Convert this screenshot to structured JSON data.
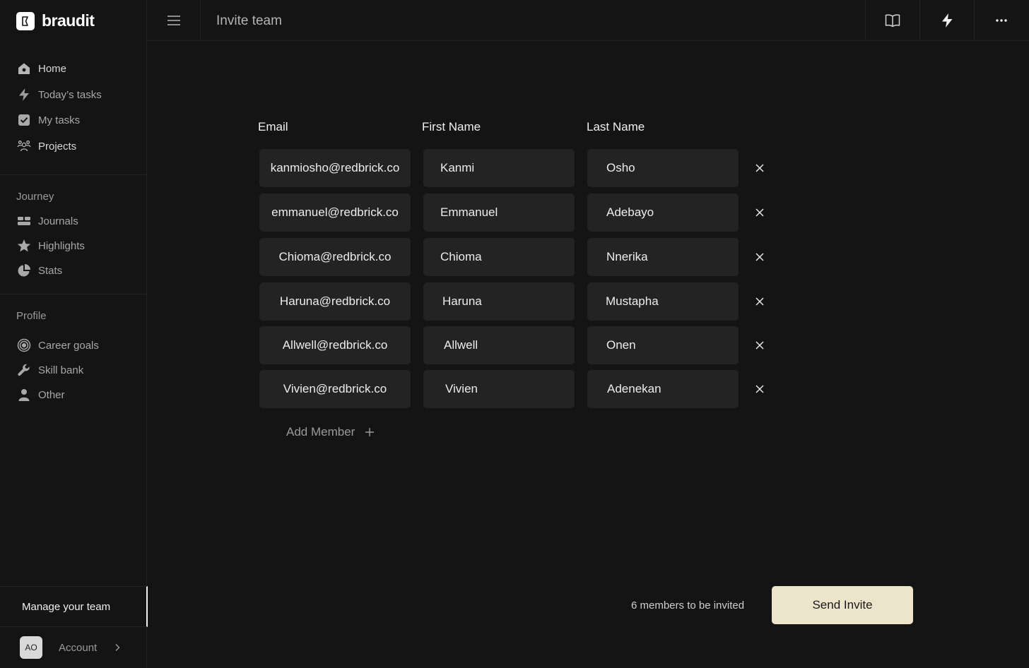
{
  "brand": {
    "name": "braudit"
  },
  "header": {
    "title": "Invite team"
  },
  "nav": {
    "main": [
      {
        "label": "Home",
        "icon": "home-icon"
      },
      {
        "label": "Today’s tasks",
        "icon": "lightning-icon"
      },
      {
        "label": "My tasks",
        "icon": "checkbox-icon"
      },
      {
        "label": "Projects",
        "icon": "people-icon"
      }
    ],
    "journey_label": "Journey",
    "journey": [
      {
        "label": "Journals",
        "icon": "journals-icon"
      },
      {
        "label": "Highlights",
        "icon": "star-icon"
      },
      {
        "label": "Stats",
        "icon": "pie-chart-icon"
      }
    ],
    "profile_label": "Profile",
    "profile": [
      {
        "label": "Career goals",
        "icon": "target-icon"
      },
      {
        "label": "Skill bank",
        "icon": "wrench-icon"
      },
      {
        "label": "Other",
        "icon": "user-icon"
      }
    ]
  },
  "sidebar_footer": {
    "manage_label": "Manage your team",
    "avatar_initials": "AO",
    "account_label": "Account"
  },
  "form": {
    "columns": {
      "email": "Email",
      "first": "First Name",
      "last": "Last Name"
    },
    "rows": [
      {
        "email": "kanmiosho@redbrick.co",
        "first": "Kanmi",
        "last": "Osho"
      },
      {
        "email": "emmanuel@redbrick.co",
        "first": "Emmanuel",
        "last": "Adebayo"
      },
      {
        "email": "Chioma@redbrick.co",
        "first": "Chioma",
        "last": "Nnerika"
      },
      {
        "email": "Haruna@redbrick.co",
        "first": "Haruna",
        "last": "Mustapha"
      },
      {
        "email": "Allwell@redbrick.co",
        "first": "Allwell",
        "last": "Onen"
      },
      {
        "email": "Vivien@redbrick.co",
        "first": "Vivien",
        "last": "Adenekan"
      }
    ],
    "add_member_label": "Add Member"
  },
  "footer": {
    "count_text": "6 members to be invited",
    "send_label": "Send Invite"
  },
  "colors": {
    "background": "#141414",
    "field": "#232323",
    "accent": "#ede4cc"
  }
}
